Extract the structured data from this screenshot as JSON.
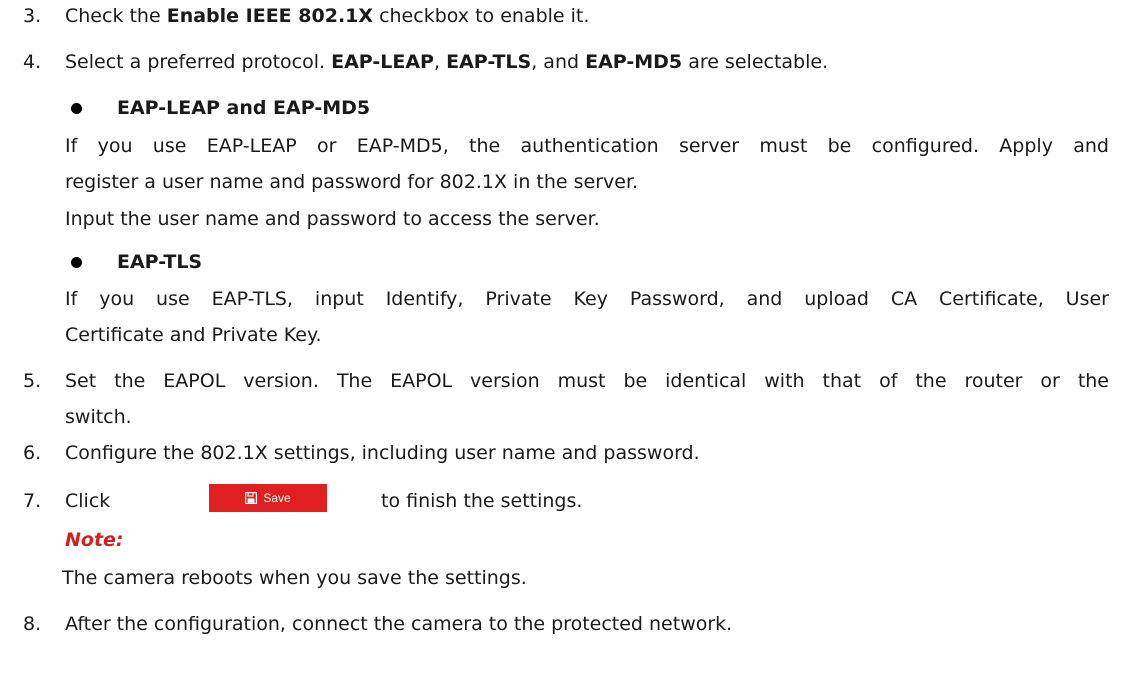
{
  "steps": {
    "s3": {
      "num": "3.",
      "pre": "Check the ",
      "b1": "Enable IEEE 802.1X",
      "post": " checkbox to enable it."
    },
    "s4": {
      "num": "4.",
      "pre": "Select a preferred protocol. ",
      "b1": "EAP-LEAP",
      "m1": ", ",
      "b2": "EAP-TLS",
      "m2": ", and ",
      "b3": "EAP-MD5",
      "post": " are selectable."
    },
    "bullet1": {
      "title": "EAP-LEAP and EAP-MD5",
      "line1": "If you use EAP-LEAP or EAP-MD5, the authentication server must be configured. Apply and",
      "line2": "register a user name and password for 802.1X in the server.",
      "line3": "Input the user name and password to access the server."
    },
    "bullet2": {
      "title": "EAP-TLS",
      "line1": "If you use EAP-TLS, input Identify, Private Key Password, and upload CA Certificate, User",
      "line2": "Certificate and Private Key."
    },
    "s5": {
      "num": "5.",
      "line1": "Set the EAPOL version. The EAPOL version must be identical with that of the router or the",
      "line2": "switch."
    },
    "s6": {
      "num": "6.",
      "text": "Configure the 802.1X settings, including user name and password."
    },
    "s7": {
      "num": "7.",
      "pre": "Click",
      "post": "to finish the settings."
    },
    "note": {
      "label": "Note:",
      "text": "The camera reboots when you save the settings."
    },
    "s8": {
      "num": "8.",
      "text": "After the configuration, connect the camera to the protected network."
    }
  },
  "save_button": {
    "label": "Save",
    "icon": "save-icon",
    "color": "#e02020"
  },
  "colors": {
    "note": "#d12020",
    "text": "#1a1a1a"
  }
}
